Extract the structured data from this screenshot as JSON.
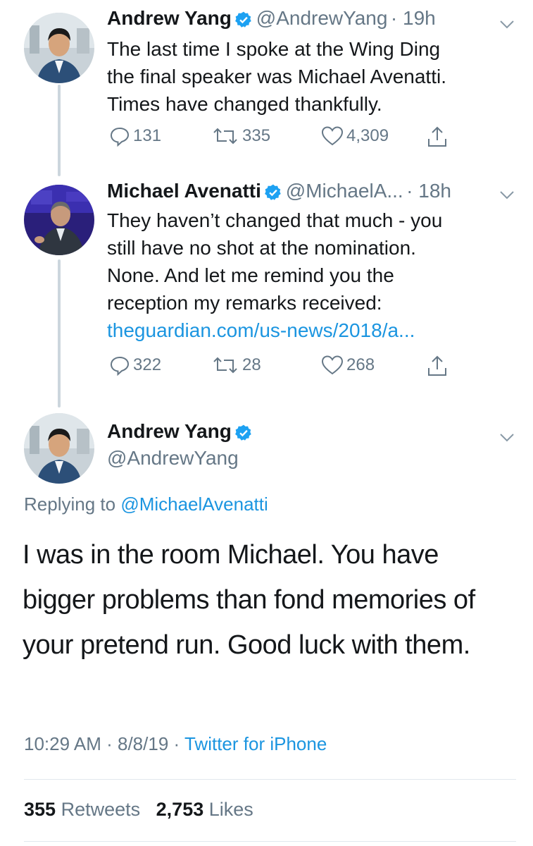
{
  "tweets": [
    {
      "name": "Andrew Yang",
      "handle": "@AndrewYang",
      "time": "· 19h",
      "text": "The last time I spoke at the Wing Ding\nthe final speaker was Michael Avenatti.\nTimes have changed thankfully.",
      "replies": "131",
      "retweets": "335",
      "likes": "4,309"
    },
    {
      "name": "Michael Avenatti",
      "handle": "@MichaelA...",
      "time": "· 18h",
      "text": "They haven’t changed that much - you\nstill have no shot at the nomination.\nNone.  And let me remind you the\nreception my remarks received:",
      "link": "theguardian.com/us-news/2018/a...",
      "replies": "322",
      "retweets": "28",
      "likes": "268"
    }
  ],
  "main_tweet": {
    "name": "Andrew Yang",
    "handle": "@AndrewYang",
    "replying_label": "Replying to",
    "replying_handle": "@MichaelAvenatti",
    "text": "I was in the room Michael. You have bigger problems than fond memories of your pretend run. Good luck with them.",
    "time": "10:29 AM",
    "date": "8/8/19",
    "source": "Twitter for iPhone",
    "retweets_count": "355",
    "retweets_label": "Retweets",
    "likes_count": "2,753",
    "likes_label": "Likes"
  },
  "colors": {
    "link": "#1b95e0",
    "verified": "#1da1f2",
    "muted": "#657786"
  }
}
